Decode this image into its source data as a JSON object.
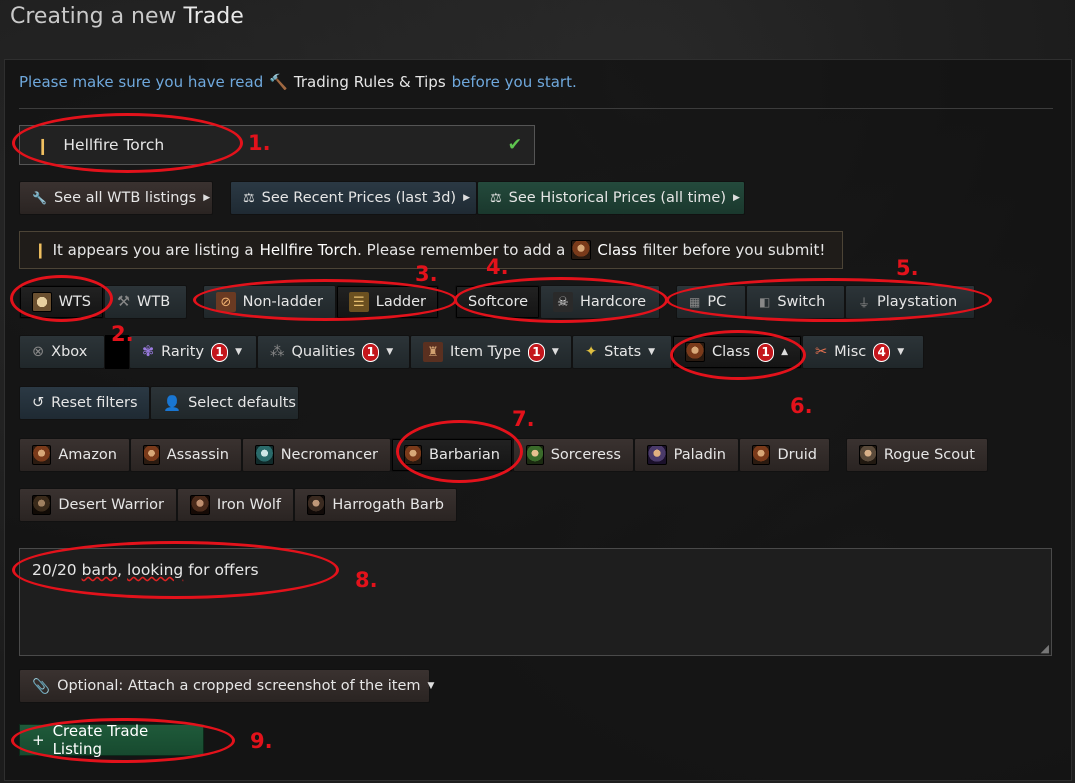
{
  "page": {
    "title_prefix": "Creating a new",
    "title_emph": "Trade"
  },
  "notice": {
    "pre": "Please make sure you have read",
    "rules": "Trading Rules & Tips",
    "post": "before you start."
  },
  "item": {
    "name": "Hellfire Torch"
  },
  "links": {
    "wtb_listings": "See all WTB listings",
    "recent_prices": "See Recent Prices (last 3d)",
    "historical_prices": "See Historical Prices (all time)"
  },
  "info": {
    "pre": "It appears you are listing a",
    "item": "Hellfire Torch",
    "mid": ". Please remember to add a",
    "filter": "Class",
    "post": "filter before you submit!"
  },
  "trade_type": {
    "wts": "WTS",
    "wtb": "WTB"
  },
  "ladder": {
    "non_ladder": "Non-ladder",
    "ladder": "Ladder"
  },
  "mode": {
    "softcore": "Softcore",
    "hardcore": "Hardcore"
  },
  "platform": {
    "pc": "PC",
    "switch": "Switch",
    "playstation": "Playstation",
    "xbox": "Xbox"
  },
  "filters": {
    "rarity": {
      "label": "Rarity",
      "count": "1"
    },
    "qualities": {
      "label": "Qualities",
      "count": "1"
    },
    "item_type": {
      "label": "Item Type",
      "count": "1"
    },
    "stats": {
      "label": "Stats"
    },
    "class": {
      "label": "Class",
      "count": "1"
    },
    "misc": {
      "label": "Misc",
      "count": "4"
    }
  },
  "actions": {
    "reset": "Reset filters",
    "defaults": "Select defaults"
  },
  "classes": {
    "amazon": "Amazon",
    "assassin": "Assassin",
    "necromancer": "Necromancer",
    "barbarian": "Barbarian",
    "sorceress": "Sorceress",
    "paladin": "Paladin",
    "druid": "Druid",
    "rogue_scout": "Rogue Scout",
    "desert_warrior": "Desert Warrior",
    "iron_wolf": "Iron Wolf",
    "harrogath_barb": "Harrogath Barb"
  },
  "description": {
    "pre": "20/20",
    "w1": "barb",
    "mid": ",",
    "w2": "looking",
    "post": "for offers"
  },
  "attach": {
    "label": "Optional: Attach a cropped screenshot of the item"
  },
  "create": {
    "label": "Create Trade Listing"
  },
  "annotations": {
    "n1": "1.",
    "n2": "2.",
    "n3": "3.",
    "n4": "4.",
    "n5": "5.",
    "n6": "6.",
    "n7": "7.",
    "n8": "8.",
    "n9": "9."
  },
  "colors": {
    "accent_red": "#e3121b",
    "link_blue": "#6fa8dc",
    "check_green": "#5ec44f",
    "create_green": "#1f5a3a"
  }
}
